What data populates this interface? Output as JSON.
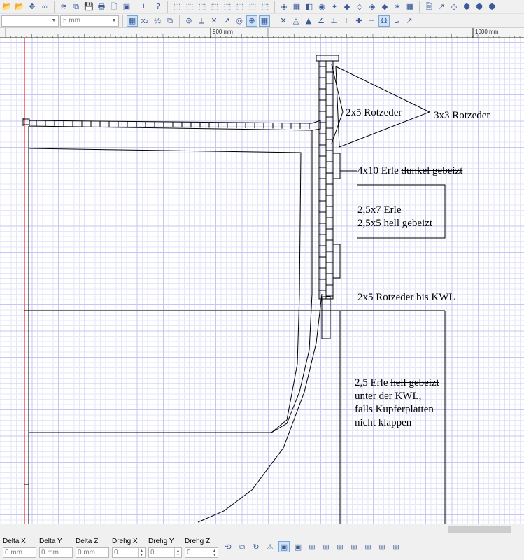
{
  "toolbar_top": {
    "icons": [
      "open-folder-icon",
      "open-icon",
      "move-icon",
      "link-icon",
      "layers-icon",
      "copy-icon",
      "save-icon",
      "print-icon",
      "new-page-icon",
      "layout-icon",
      "axis-icon",
      "help-pointer-icon",
      "cube-icon",
      "cube-icon",
      "cube-icon",
      "cube-icon",
      "cube-icon",
      "cube-icon",
      "cube-icon",
      "cube-icon",
      "rgb-icon",
      "grid-icon",
      "layers-icon",
      "palette-icon",
      "chart-icon",
      "shape-icon",
      "shape-icon",
      "shape-icon",
      "shape-icon",
      "star-icon",
      "grid-icon",
      "document-icon",
      "arrow-icon",
      "shape-icon",
      "cube-icon",
      "cube-icon",
      "cube-icon"
    ],
    "glyphs": [
      "📂",
      "📂",
      "✥",
      "∞",
      "≋",
      "⧉",
      "💾",
      "🖶",
      "🗋",
      "▣",
      "∟",
      "?",
      "⬚",
      "⬚",
      "⬚",
      "⬚",
      "⬚",
      "⬚",
      "⬚",
      "⬚",
      "◈",
      "▦",
      "◧",
      "◉",
      "✦",
      "◆",
      "◇",
      "◈",
      "◆",
      "✶",
      "▦",
      "🗎",
      "↗",
      "◇",
      "⬢",
      "⬢",
      "⬢"
    ]
  },
  "toolbar_second": {
    "combo1_value": "",
    "combo2_value": "5 mm",
    "icons": [
      "grid-snap-icon",
      "x2-icon",
      "half-icon",
      "layers-icon",
      "snap-point-icon",
      "perpendicular-icon",
      "tangent-icon",
      "midpoint-icon",
      "center-icon",
      "intersection-icon",
      "grid-icon",
      "cross-icon",
      "endpoint-icon",
      "triangle-icon",
      "angle-icon",
      "edge-icon",
      "vertical-icon",
      "horizontal-icon",
      "axis-icon",
      "magnet-icon",
      "angle-icon",
      "arrow-icon"
    ],
    "glyphs": [
      "▦",
      "x₂",
      "½",
      "⧉",
      "⊙",
      "⟂",
      "✕",
      "↗",
      "◎",
      "⊕",
      "▦",
      "✕",
      "◬",
      "▲",
      "∠",
      "⊥",
      "⊤",
      "✚",
      "⊢",
      "Ω",
      "⦟",
      "↗"
    ],
    "active": [
      0,
      9,
      10,
      19
    ]
  },
  "ruler": {
    "labels": [
      "900 mm",
      "1000 mm"
    ]
  },
  "annotations": {
    "a1": "2x5 Rotzeder",
    "a2": "3x3 Rotzeder",
    "a3_plain": "4x10 Erle ",
    "a3_strike": "dunkel gebeizt",
    "a4_line1": "2,5x7 Erle",
    "a4_plain": "2,5x5 ",
    "a4_strike": "hell gebeizt",
    "a5": "2x5 Rotzeder bis KWL",
    "a6_plain": "2,5 Erle ",
    "a6_strike": "hell gebeizt",
    "a6_line2": "unter der KWL,",
    "a6_line3": "falls Kupferplatten",
    "a6_line4": "nicht klappen"
  },
  "colors": {
    "grid_major": "#c6c6f2",
    "grid_minor": "#e6e6fa",
    "origin_line": "#e00000",
    "drawing": "#000000"
  },
  "status": {
    "fields": [
      {
        "label": "Delta X",
        "value": "0 mm"
      },
      {
        "label": "Delta Y",
        "value": "0 mm"
      },
      {
        "label": "Delta Z",
        "value": "0 mm"
      },
      {
        "label": "Drehg X",
        "value": "0"
      },
      {
        "label": "Drehg Y",
        "value": "0"
      },
      {
        "label": "Drehg Z",
        "value": "0"
      }
    ],
    "icons": [
      "move-view-icon",
      "transform-icon",
      "rotate-icon",
      "mirror-icon",
      "frame-icon",
      "frame-icon",
      "grid-icon",
      "grid-icon",
      "grid-icon",
      "grid-icon",
      "grid-icon",
      "grid-icon",
      "grid-icon"
    ],
    "glyphs": [
      "⟲",
      "⧉",
      "↻",
      "⚠",
      "▣",
      "▣",
      "⊞",
      "⊞",
      "⊞",
      "⊞",
      "⊞",
      "⊞",
      "⊞"
    ]
  }
}
